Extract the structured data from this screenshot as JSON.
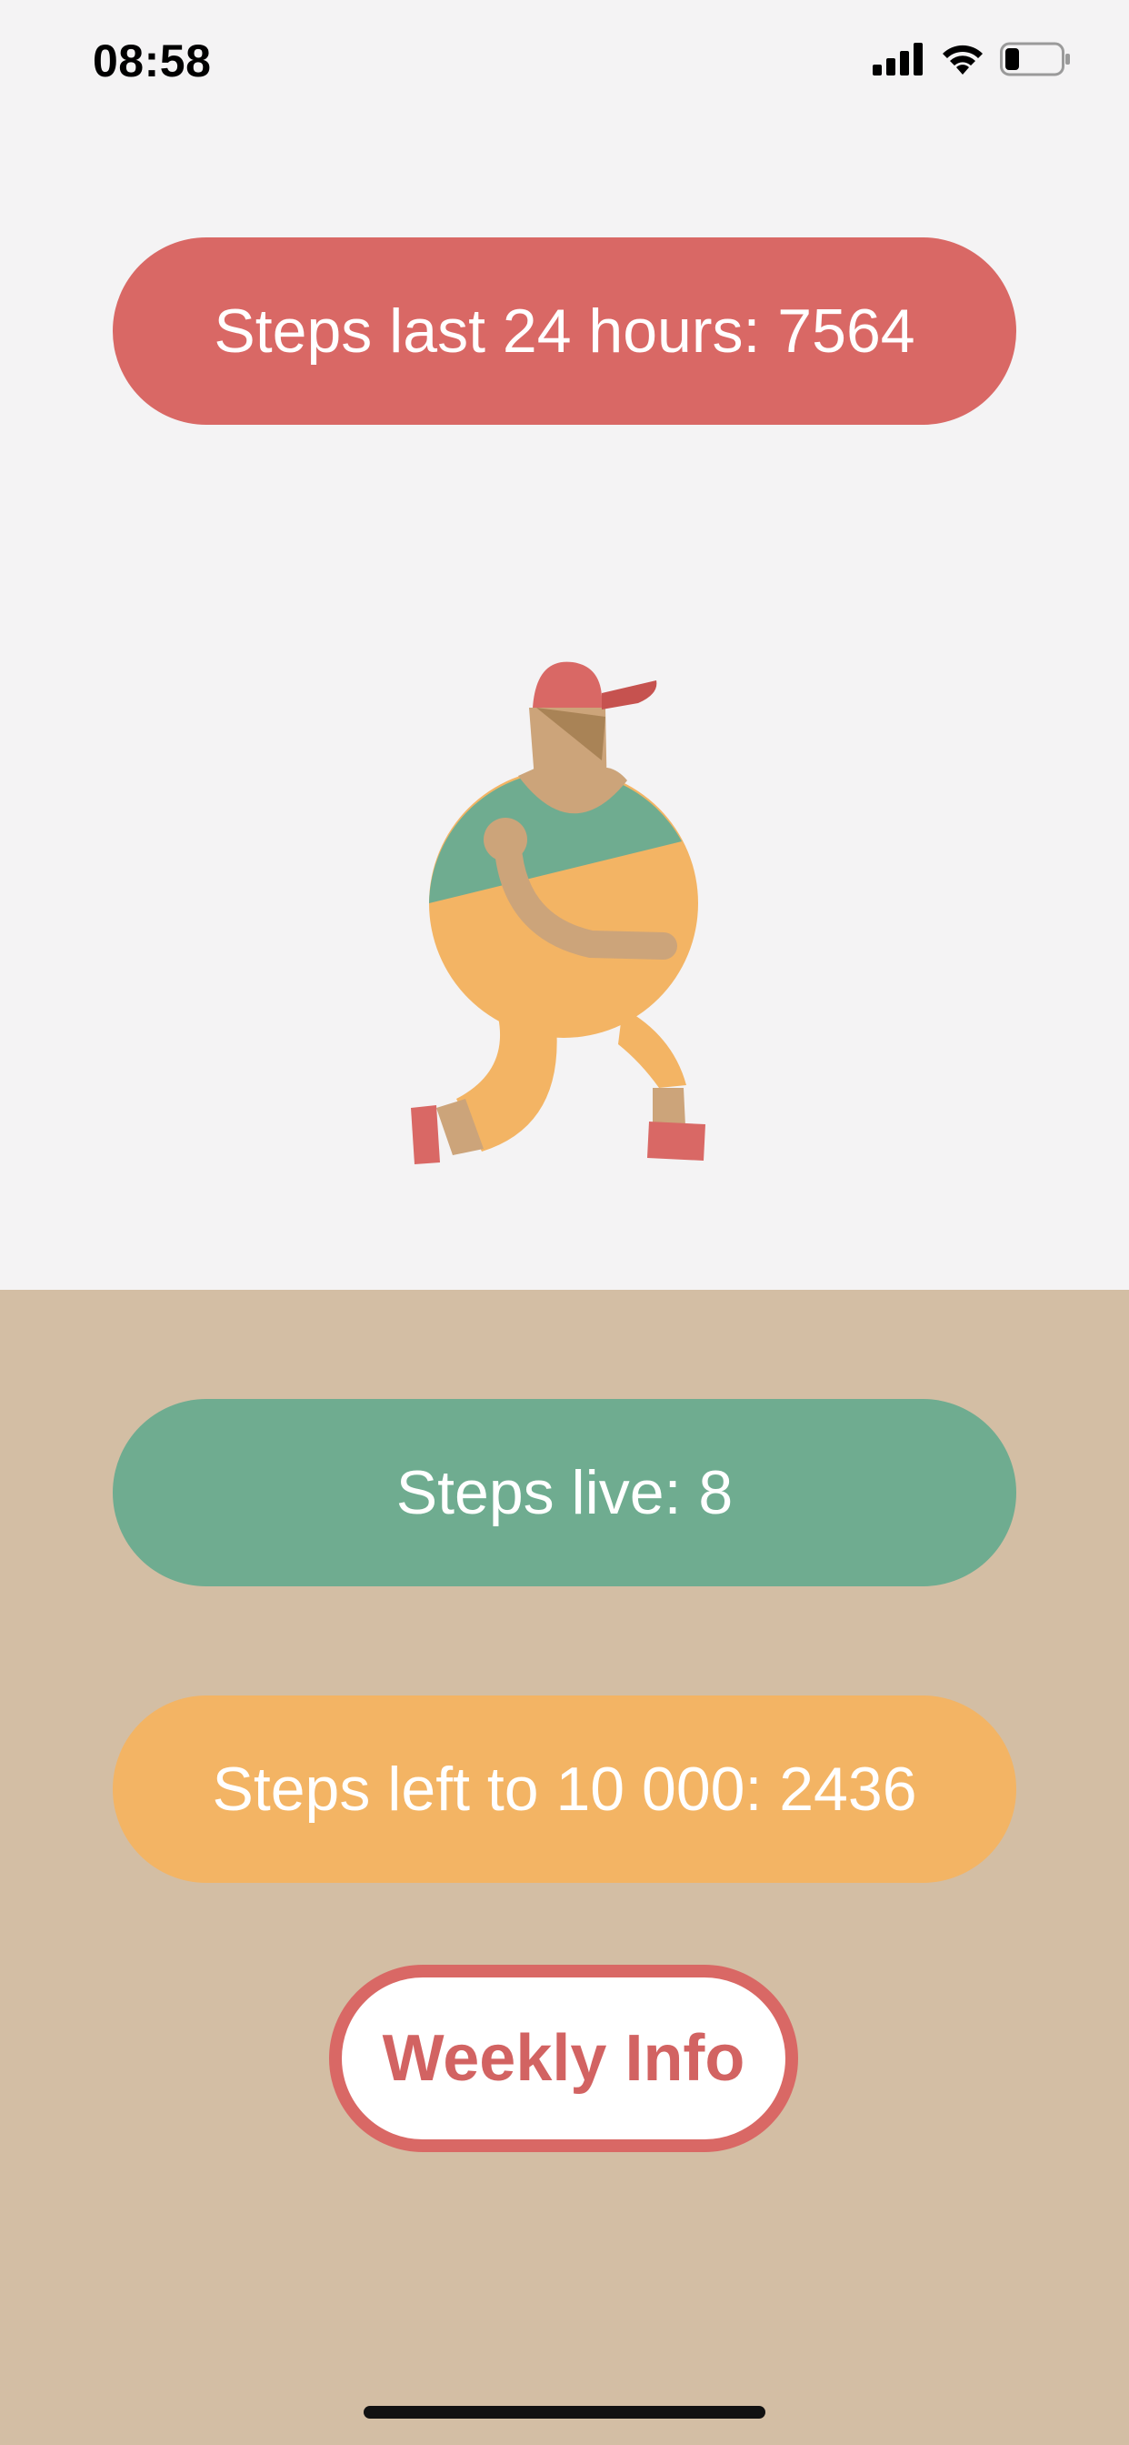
{
  "status_bar": {
    "time": "08:58",
    "icons": [
      "signal-icon",
      "wifi-icon",
      "battery-icon"
    ],
    "battery_level": 0.25
  },
  "main": {
    "steps_last_24h_label": "Steps last 24 hours: 7564",
    "steps_live_label": "Steps live: 8",
    "steps_left_label": "Steps left to 10 000: 2436",
    "weekly_button_label": "Weekly Info"
  },
  "colors": {
    "background_top": "#f4f3f4",
    "background_bottom": "#d3bea4",
    "red": "#d96865",
    "green": "#6fac90",
    "orange": "#f3b464",
    "skin": "#cca47a"
  }
}
